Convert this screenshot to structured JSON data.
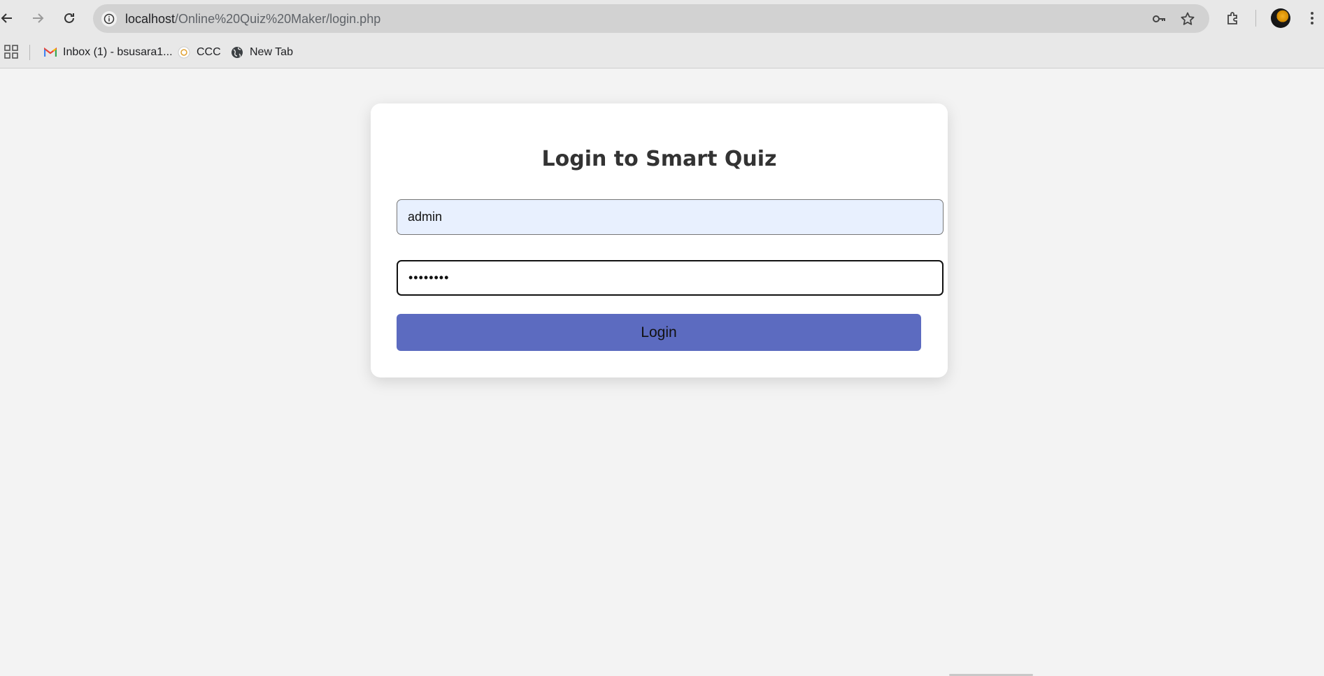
{
  "browser": {
    "url_host": "localhost",
    "url_path": "/Online%20Quiz%20Maker/login.php",
    "bookmarks": [
      {
        "label": "Inbox (1) - bsusara1...",
        "icon": "gmail-icon"
      },
      {
        "label": "CCC",
        "icon": "site-favicon-icon"
      },
      {
        "label": "New Tab",
        "icon": "globe-icon"
      }
    ]
  },
  "login": {
    "title": "Login to Smart Quiz",
    "username_value": "admin",
    "password_mask": "••••••••",
    "button_label": "Login"
  },
  "colors": {
    "button": "#5c6bc0",
    "autofill_bg": "#e8f0fe",
    "page_bg": "#f3f3f3",
    "card_bg": "#ffffff"
  }
}
